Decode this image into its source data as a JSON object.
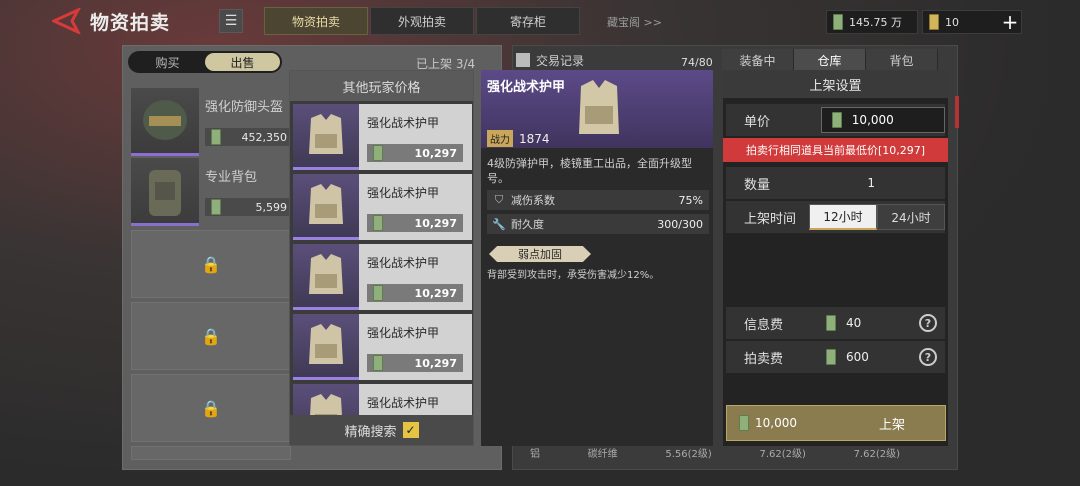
{
  "header": {
    "title": "物资拍卖",
    "tabs": [
      {
        "label": "物资拍卖",
        "active": true
      },
      {
        "label": "外观拍卖",
        "active": false
      },
      {
        "label": "寄存柜",
        "active": false
      }
    ],
    "treasure_link": "藏宝阁 >>",
    "currency_cash": "145.75 万",
    "currency_gold": "10",
    "plus": "+"
  },
  "left": {
    "segments": [
      {
        "label": "购买",
        "active": false
      },
      {
        "label": "出售",
        "active": true
      }
    ],
    "listed_count": "已上架  3/4",
    "items": [
      {
        "name": "强化防御头盔",
        "price": "452,350",
        "icon": "helmet-icon"
      },
      {
        "name": "专业背包",
        "price": "5,599",
        "icon": "backpack-icon"
      }
    ]
  },
  "popup": {
    "title": "其他玩家价格",
    "offers": [
      {
        "name": "强化战术护甲",
        "price": "10,297"
      },
      {
        "name": "强化战术护甲",
        "price": "10,297"
      },
      {
        "name": "强化战术护甲",
        "price": "10,297"
      },
      {
        "name": "强化战术护甲",
        "price": "10,297"
      },
      {
        "name": "强化战术护甲",
        "price": ""
      }
    ],
    "exact_search": "精确搜索"
  },
  "detail": {
    "name": "强化战术护甲",
    "power_label": "战力",
    "power_value": "1874",
    "description": "4级防弹护甲，棱镜重工出品，全面升级型号。",
    "stats": [
      {
        "label": "减伤系数",
        "value": "75%",
        "icon": "shield-icon"
      },
      {
        "label": "耐久度",
        "value": "300/300",
        "icon": "wrench-icon"
      }
    ],
    "weak_tag": "弱点加固",
    "weak_desc": "背部受到攻击时，承受伤害减少12%。"
  },
  "inventory": {
    "record_label": "交易记录",
    "capacity": "74/80",
    "tabs": [
      {
        "label": "装备中",
        "active": false
      },
      {
        "label": "仓库",
        "active": true
      },
      {
        "label": "背包",
        "active": false
      }
    ],
    "bottom_stats": [
      "铝",
      "碳纤维",
      "5.56(2级)",
      "7.62(2级)",
      "7.62(2级)"
    ]
  },
  "settings": {
    "title": "上架设置",
    "unit_price_label": "单价",
    "unit_price": "10,000",
    "warning": "拍卖行相同道具当前最低价[10,297]",
    "qty_label": "数量",
    "qty": "1",
    "time_label": "上架时间",
    "time_options": [
      {
        "label": "12小时",
        "active": true
      },
      {
        "label": "24小时",
        "active": false
      }
    ],
    "info_fee_label": "信息费",
    "info_fee": "40",
    "auction_fee_label": "拍卖费",
    "auction_fee": "600",
    "submit_price": "10,000",
    "submit_label": "上架",
    "help": "?"
  }
}
